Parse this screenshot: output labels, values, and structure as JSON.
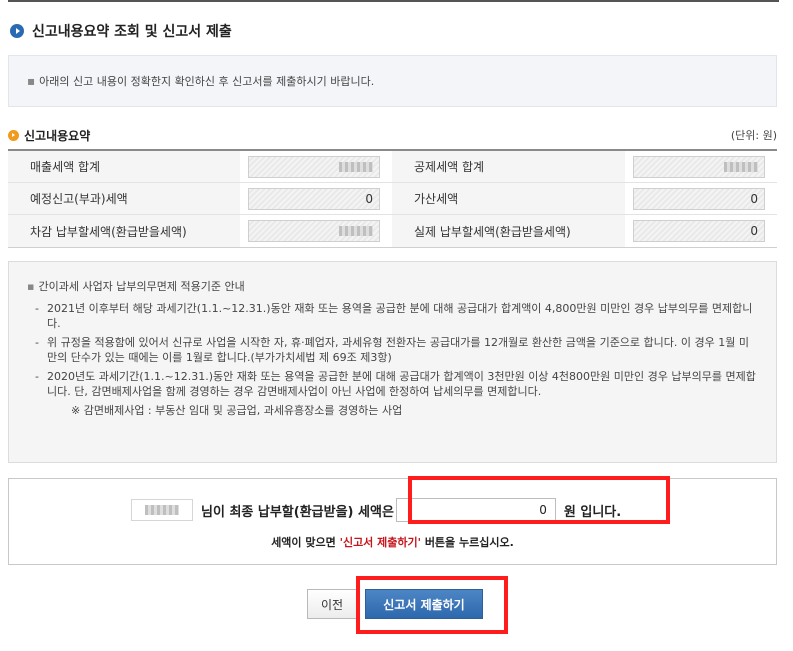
{
  "page": {
    "title": "신고내용요약 조회 및 신고서 제출",
    "notice": "아래의 신고 내용이 정확한지 확인하신 후 신고서를 제출하시기 바랍니다."
  },
  "summary": {
    "title": "신고내용요약",
    "unit": "(단위: 원)",
    "rows": [
      {
        "left_label": "매출세액 합계",
        "left_value": "",
        "right_label": "공제세액 합계",
        "right_value": ""
      },
      {
        "left_label": "예정신고(부과)세액",
        "left_value": "0",
        "right_label": "가산세액",
        "right_value": "0"
      },
      {
        "left_label": "차감 납부할세액(환급받을세액)",
        "left_value": "",
        "right_label": "실제 납부할세액(환급받을세액)",
        "right_value": "0"
      }
    ]
  },
  "guide": {
    "title": "간이과세 사업자 납부의무면제 적용기준 안내",
    "items": [
      "2021년 이후부터 해당 과세기간(1.1.~12.31.)동안 재화 또는 용역을 공급한 분에 대해 공급대가 합계액이 4,800만원 미만인 경우 납부의무를 면제합니다.",
      "위 규정을 적용함에 있어서 신규로 사업을 시작한 자, 휴·폐업자, 과세유형 전환자는 공급대가를 12개월로 환산한 금액을 기준으로 합니다. 이 경우 1월 미만의 단수가 있는 때에는 이를 1월로 합니다.(부가가치세법 제 69조 제3항)",
      "2020년도 과세기간(1.1.~12.31.)동안 재화 또는 용역을 공급한 분에 대해 공급대가 합계액이 3천만원 이상 4천800만원 미만인 경우 납부의무를 면제합니다. 단, 감면배제사업을 함께 경영하는 경우 감면배제사업이 아닌 사업에 한정하여 납세의무를 면제합니다."
    ],
    "note": "※ 감면배제사업 : 부동산 임대 및 공급업, 과세유흥장소를 경영하는 사업"
  },
  "final": {
    "name_value": "",
    "text_before": "님이 최종 납부할(환급받을) 세액은",
    "amount": "0",
    "text_after": "원 입니다.",
    "sub_before": "세액이 맞으면 ",
    "sub_highlight": "'신고서 제출하기'",
    "sub_after": " 버튼을 누르십시오."
  },
  "buttons": {
    "prev": "이전",
    "submit": "신고서 제출하기"
  },
  "colors": {
    "accent_blue": "#2e68ad",
    "highlight_red": "#ff1c1c",
    "emphasis_red": "#c4161c",
    "orange_bullet": "#f19a1c"
  }
}
